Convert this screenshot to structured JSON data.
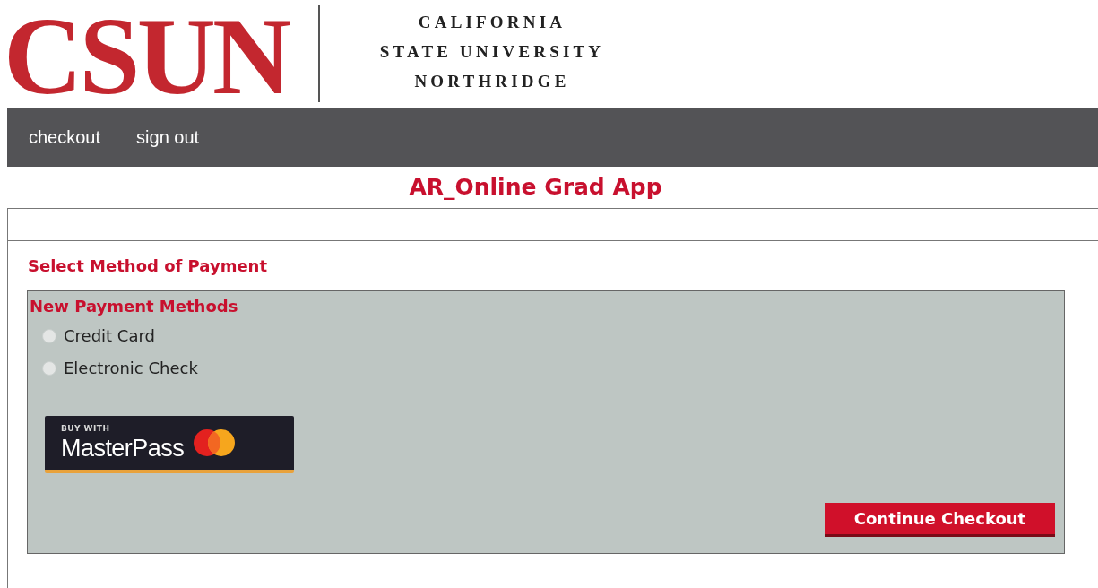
{
  "logo": {
    "wordmark": "CSUN",
    "lines": [
      "CALIFORNIA",
      "STATE UNIVERSITY",
      "NORTHRIDGE"
    ]
  },
  "nav": [
    "checkout",
    "sign out"
  ],
  "page_title": "AR_Online Grad App",
  "section_title": "Select Method of Payment",
  "panel": {
    "heading": "New Payment Methods",
    "options": [
      {
        "label": "Credit Card",
        "selected": false
      },
      {
        "label": "Electronic Check",
        "selected": false
      }
    ],
    "masterpass": {
      "caption": "BUY WITH",
      "brand": "MasterPass"
    },
    "button": "Continue Checkout"
  }
}
